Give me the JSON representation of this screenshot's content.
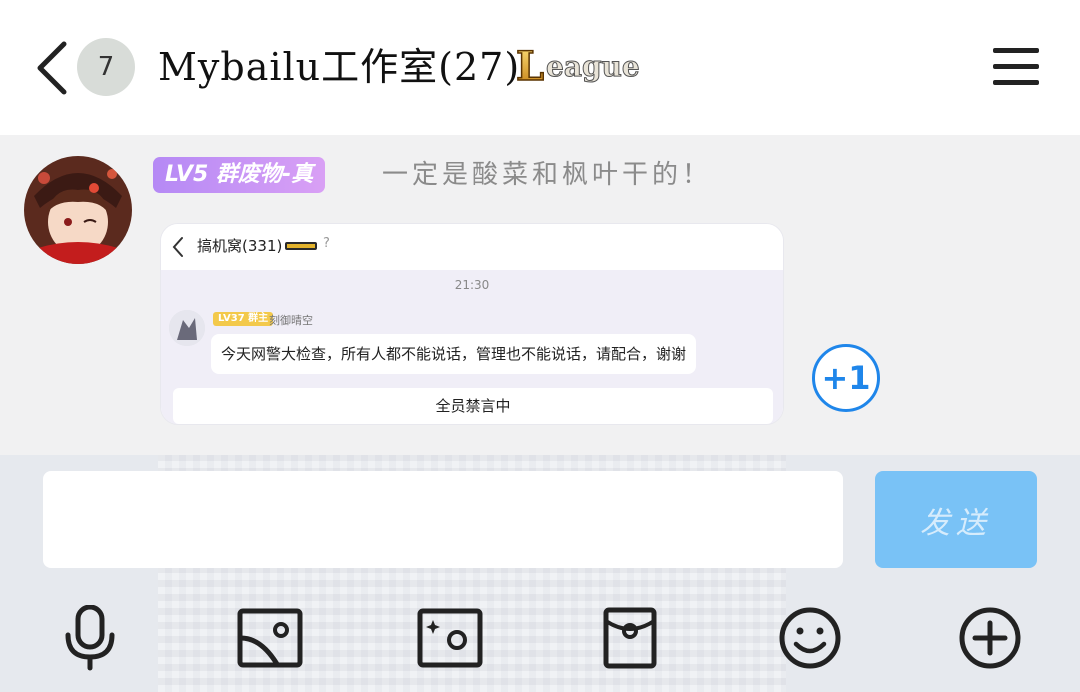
{
  "header": {
    "unread_count": "7",
    "title": "Mybailu工作室(27)",
    "badge_logo_text": "League"
  },
  "message": {
    "level_badge": "LV5 群废物-真",
    "sender_name": "一定是酸菜和枫叶干的！",
    "plus_one_label": "+1",
    "screenshot": {
      "title": "搞机窝(331)",
      "help_icon": "?",
      "time": "21:30",
      "inner_level": "LV37 群主",
      "inner_sender": "刻御晴空",
      "inner_message": "今天网警大检查，所有人都不能说话，管理也不能说话，请配合，谢谢",
      "inner_banner": "全员禁言中"
    }
  },
  "composer": {
    "input_value": "",
    "input_placeholder": "",
    "send_label": "发送"
  },
  "toolbar": {
    "icons": [
      "microphone-icon",
      "image-icon",
      "camera-icon",
      "red-packet-icon",
      "emoji-icon",
      "plus-icon"
    ]
  },
  "colors": {
    "accent": "#1f86ea",
    "send_button": "#79c2f6",
    "level_badge_start": "#b589f5",
    "level_badge_end": "#d9a0f5"
  }
}
